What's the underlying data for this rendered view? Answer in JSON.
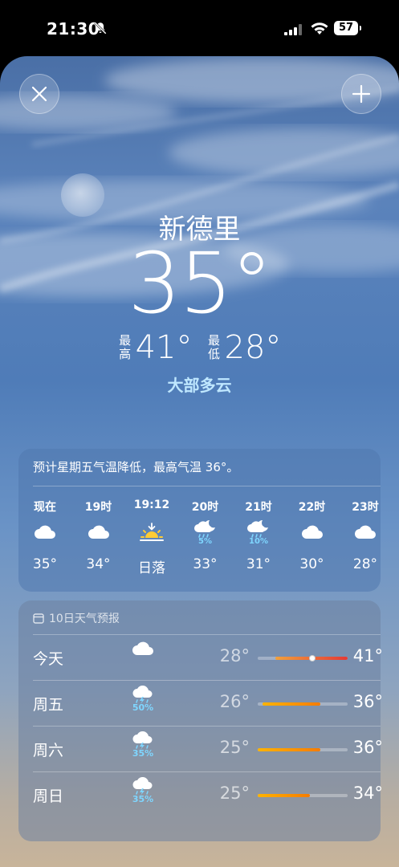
{
  "status_bar": {
    "time": "21:30",
    "battery": "57"
  },
  "location": {
    "city": "新德里",
    "current_temp": "35°",
    "high_label": "最高",
    "high": "41°",
    "low_label": "最低",
    "low": "28°",
    "condition": "大部多云"
  },
  "hourly": {
    "note": "预计星期五气温降低，最高气温 36°。",
    "items": [
      {
        "time": "现在",
        "icon": "cloud-icon",
        "pct": "",
        "temp": "35°"
      },
      {
        "time": "19时",
        "icon": "cloud-icon",
        "pct": "",
        "temp": "34°"
      },
      {
        "time": "19:12",
        "icon": "sunset-icon",
        "pct": "",
        "temp": "日落"
      },
      {
        "time": "20时",
        "icon": "moon-cloud-rain-icon",
        "pct": "5%",
        "temp": "33°"
      },
      {
        "time": "21时",
        "icon": "moon-cloud-rain-icon",
        "pct": "10%",
        "temp": "31°"
      },
      {
        "time": "22时",
        "icon": "cloud-icon",
        "pct": "",
        "temp": "30°"
      },
      {
        "time": "23时",
        "icon": "cloud-icon",
        "pct": "",
        "temp": "28°"
      }
    ]
  },
  "daily": {
    "title": "10日天气预报",
    "items": [
      {
        "day": "今天",
        "icon": "cloud-icon",
        "pct": "",
        "low": "28°",
        "high": "41°",
        "range": [
          0.2,
          1.0
        ],
        "current": 0.6,
        "colors": [
          "#f2a03a",
          "#e53935"
        ]
      },
      {
        "day": "周五",
        "icon": "thunderstorm-icon",
        "pct": "50%",
        "low": "26°",
        "high": "36°",
        "range": [
          0.05,
          0.7
        ],
        "colors": [
          "#ffb300",
          "#f57c00"
        ]
      },
      {
        "day": "周六",
        "icon": "thunderstorm-icon",
        "pct": "35%",
        "low": "25°",
        "high": "36°",
        "range": [
          0.0,
          0.7
        ],
        "colors": [
          "#ffb300",
          "#f57c00"
        ]
      },
      {
        "day": "周日",
        "icon": "thunderstorm-icon",
        "pct": "35%",
        "low": "25°",
        "high": "34°",
        "range": [
          0.0,
          0.58
        ],
        "colors": [
          "#ffb300",
          "#f57c00"
        ]
      }
    ]
  }
}
